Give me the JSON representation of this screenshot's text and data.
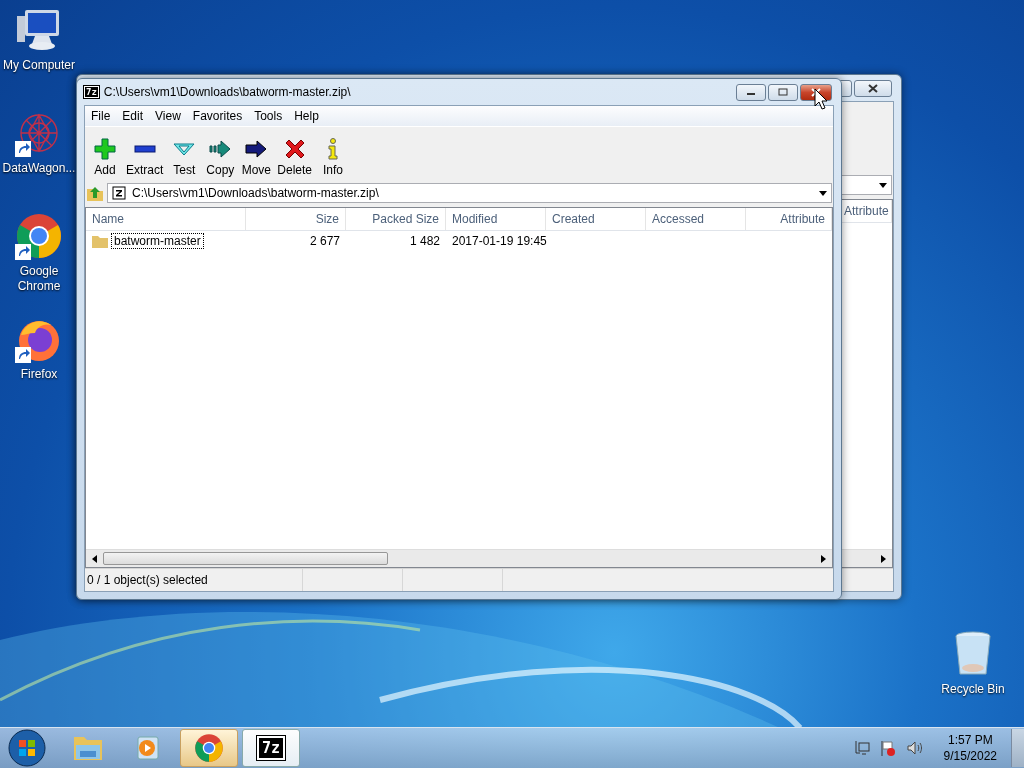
{
  "desktop_icons": [
    {
      "kind": "computer",
      "label": "My Computer",
      "shortcut": false
    },
    {
      "kind": "web",
      "label": "DataWagon...",
      "shortcut": true
    },
    {
      "kind": "chrome",
      "label": "Google Chrome",
      "shortcut": true
    },
    {
      "kind": "firefox",
      "label": "Firefox",
      "shortcut": true
    }
  ],
  "recycle_bin": {
    "label": "Recycle Bin"
  },
  "background_window": {
    "column": "Attribute"
  },
  "window": {
    "logo": "7z",
    "title": "C:\\Users\\vm1\\Downloads\\batworm-master.zip\\",
    "close_hovered": true,
    "menu": [
      "File",
      "Edit",
      "View",
      "Favorites",
      "Tools",
      "Help"
    ],
    "toolbar": [
      {
        "kind": "add",
        "label": "Add"
      },
      {
        "kind": "extract",
        "label": "Extract"
      },
      {
        "kind": "test",
        "label": "Test"
      },
      {
        "kind": "copy",
        "label": "Copy"
      },
      {
        "kind": "move",
        "label": "Move"
      },
      {
        "kind": "delete",
        "label": "Delete"
      },
      {
        "kind": "info",
        "label": "Info"
      }
    ],
    "address": "C:\\Users\\vm1\\Downloads\\batworm-master.zip\\",
    "table": {
      "columns": [
        "Name",
        "Size",
        "Packed Size",
        "Modified",
        "Created",
        "Accessed",
        "Attribute"
      ],
      "rows": [
        {
          "name": "batworm-master",
          "size": "2 677",
          "packed_size": "1 482",
          "modified": "2017-01-19 19:45",
          "focused": true
        }
      ]
    },
    "status_bar": "0 / 1 object(s) selected"
  },
  "taskbar": {
    "items": [
      {
        "kind": "explorer",
        "open": false
      },
      {
        "kind": "media",
        "open": false
      },
      {
        "kind": "chrome",
        "open": true,
        "selected": false
      },
      {
        "kind": "sevenzip",
        "open": true,
        "selected": true,
        "logo": "7z"
      }
    ],
    "time": "1:57 PM",
    "date": "9/15/2022"
  }
}
